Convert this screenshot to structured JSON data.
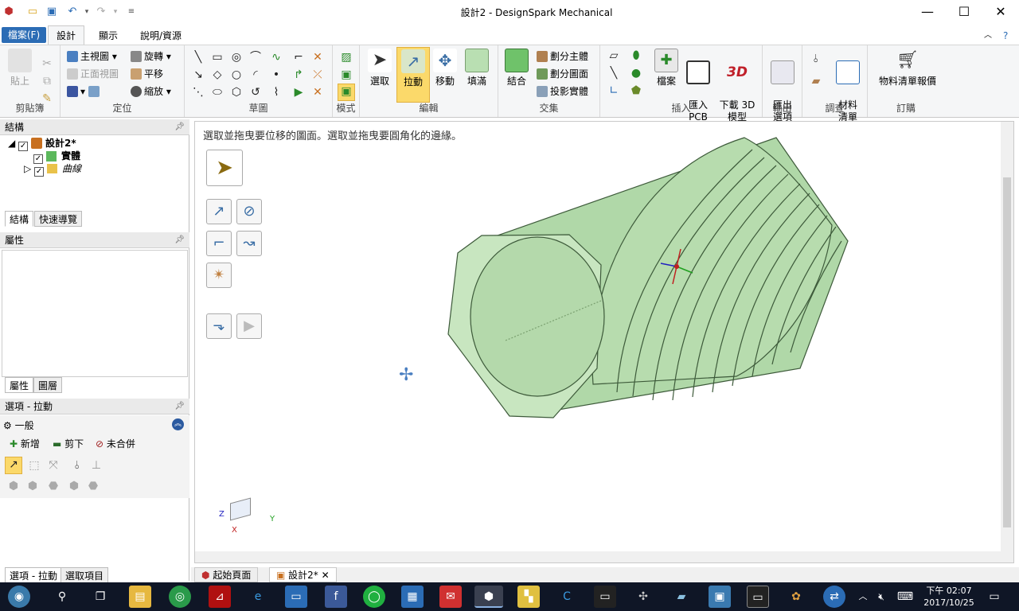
{
  "window": {
    "title": "設計2 - DesignSpark Mechanical"
  },
  "quick_access": [
    "app-icon",
    "open-icon",
    "save-icon",
    "undo-icon",
    "undo-dropdown-icon",
    "redo-icon",
    "redo-dropdown-icon",
    "customize-icon"
  ],
  "window_buttons": {
    "minimize": "—",
    "maximize": "☐",
    "close": "✕"
  },
  "tabs": {
    "file": "檔案(F)",
    "design": "設計",
    "display": "顯示",
    "help": "說明/資源"
  },
  "ribbon": {
    "clipboard": {
      "label": "剪貼簿",
      "paste": "貼上"
    },
    "orient": {
      "label": "定位",
      "home": "主視圖",
      "front": "正面視圖",
      "rotate": "旋轉",
      "pan": "平移",
      "zoom": "縮放"
    },
    "sketch": {
      "label": "草圖"
    },
    "mode": {
      "label": "模式"
    },
    "edit": {
      "label": "編輯",
      "select": "選取",
      "pull": "拉動",
      "move": "移動",
      "fill": "填滿"
    },
    "intersect": {
      "label": "交集",
      "combine": "結合",
      "split_body": "劃分主體",
      "split_face": "劃分圖面",
      "project": "投影實體"
    },
    "insert": {
      "label": "插入",
      "file": "檔案",
      "import_pcb": "匯入\nPCB",
      "download_3d": "下載 3D\n模型"
    },
    "output": {
      "label": "輸出",
      "export": "匯出\n選項"
    },
    "investigate": {
      "label": "調查",
      "materials": "材料\n清單"
    },
    "order": {
      "label": "訂購",
      "bom": "物料清單報價"
    }
  },
  "structure": {
    "header": "結構",
    "tree": [
      {
        "label": "設計2*",
        "bold": true
      },
      {
        "label": "實體",
        "bold": true
      },
      {
        "label": "曲線",
        "italic": true
      }
    ],
    "tabs": [
      "結構",
      "快速導覽"
    ]
  },
  "properties": {
    "header": "屬性",
    "tabs": [
      "屬性",
      "圖層"
    ]
  },
  "options": {
    "header": "選項 - 拉動",
    "section": "一般",
    "add": "新增",
    "cut": "剪下",
    "no_merge": "未合併"
  },
  "bottom_tabs": [
    "選項 - 拉動",
    "選取項目"
  ],
  "viewport": {
    "hint": "選取並拖曳要位移的圖面。選取並拖曳要圓角化的邊緣。",
    "axes": {
      "x": "X",
      "y": "Y",
      "z": "Z"
    }
  },
  "doc_tabs": [
    "起始頁面",
    "設計2*"
  ],
  "taskbar": {
    "time": "下午 02:07",
    "date": "2017/10/25"
  },
  "colors": {
    "accent": "#2b6cb5",
    "model": "#b9dfb2",
    "model_edge": "#3d5a3a",
    "taskbar": "#0f1626"
  }
}
